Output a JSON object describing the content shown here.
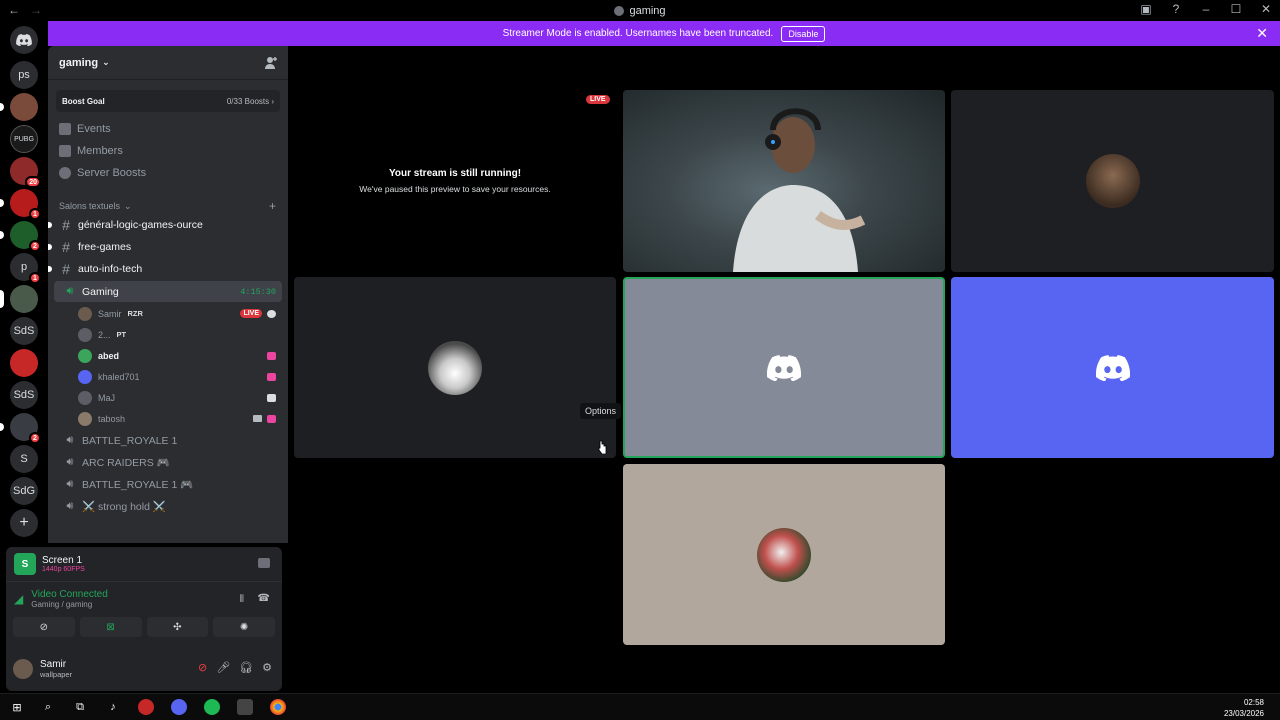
{
  "window": {
    "title": "gaming"
  },
  "banner": {
    "text": "Streamer Mode is enabled. Usernames have been truncated.",
    "button": "Disable"
  },
  "guilds": {
    "items": [
      {
        "label": "",
        "kind": "discord-home"
      },
      {
        "label": "ps",
        "kind": "text"
      },
      {
        "label": "",
        "kind": "image"
      },
      {
        "label": "",
        "kind": "image"
      },
      {
        "label": "",
        "kind": "image",
        "badge": "20"
      },
      {
        "label": "",
        "kind": "image",
        "badge": "1"
      },
      {
        "label": "",
        "kind": "image",
        "badge": "2"
      },
      {
        "label": "p",
        "kind": "text",
        "badge": "1"
      },
      {
        "label": "",
        "kind": "image"
      },
      {
        "label": "SdS",
        "kind": "text"
      },
      {
        "label": "",
        "kind": "image"
      },
      {
        "label": "SdS",
        "kind": "text"
      },
      {
        "label": "",
        "kind": "image",
        "badge": "2"
      },
      {
        "label": "S",
        "kind": "text"
      },
      {
        "label": "SdG",
        "kind": "text"
      },
      {
        "label": "+",
        "kind": "add"
      }
    ]
  },
  "server": {
    "name": "gaming",
    "boost_label": "Boost Goal",
    "boost_value": "0/33 Boosts ›",
    "menu": [
      "Events",
      "Members",
      "Server Boosts"
    ],
    "category": "Salons textuels",
    "text_channels": [
      "général-logic-games-ource",
      "free-games",
      "auto-info-tech"
    ],
    "active_voice": {
      "name": "Gaming",
      "timer": "4:15:30"
    },
    "members": [
      {
        "name": "Samir",
        "tag": "RZR",
        "live": "LIVE"
      },
      {
        "name": "2...",
        "tag": "PT"
      },
      {
        "name": "abed"
      },
      {
        "name": "khaled701"
      },
      {
        "name": "MaJ"
      },
      {
        "name": "tabosh"
      }
    ],
    "voice_channels": [
      "BATTLE_ROYALE 1",
      "ARC RAIDERS 🎮",
      "BATTLE_ROYALE 1 🎮",
      "⚔️ strong hold ⚔️"
    ]
  },
  "panel": {
    "screen_title": "Screen 1",
    "screen_quality": "1440p 60FPS",
    "screen_icon_letter": "S",
    "vc_status": "Video Connected",
    "vc_channel": "Gaming / gaming",
    "username": "Samir",
    "user_status": "wallpaper"
  },
  "stage": {
    "paused_title": "Your stream is still running!",
    "paused_sub": "We've paused this preview to save your resources.",
    "live": "LIVE",
    "tooltip": "Options"
  },
  "clock": {
    "time": "02:58",
    "date": "23/03/2026"
  },
  "colors": {
    "banner": "#8b2cf5",
    "blurple": "#5865f2",
    "green": "#23a55a",
    "red": "#da373c"
  }
}
